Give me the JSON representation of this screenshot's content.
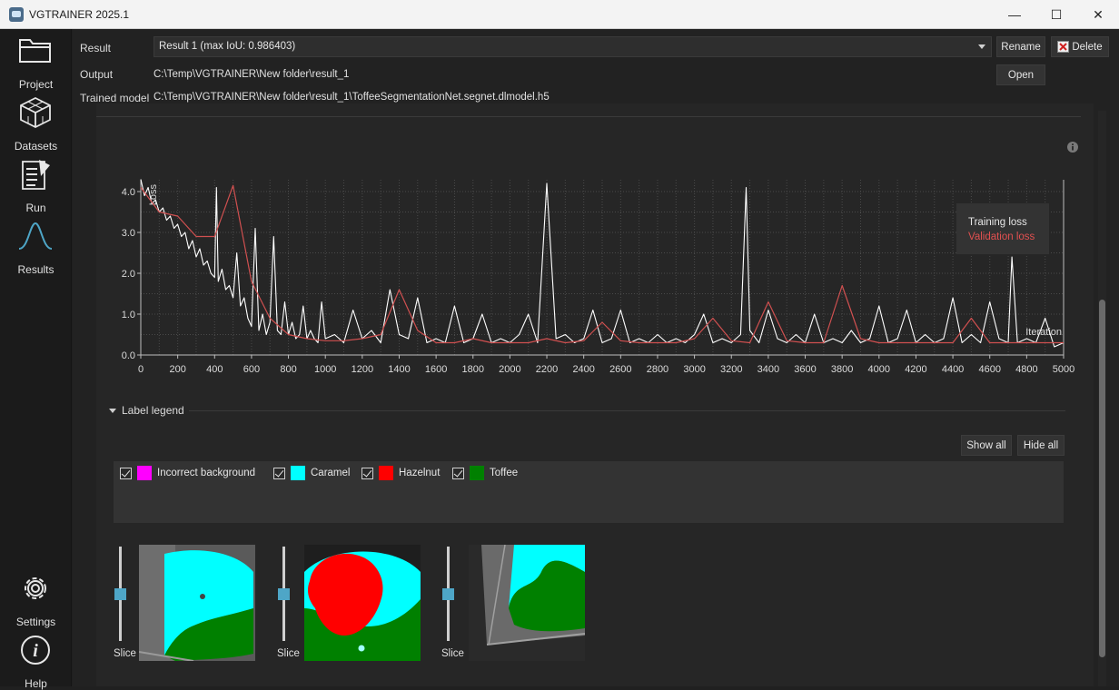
{
  "window": {
    "title": "VGTRAINER 2025.1",
    "controls": {
      "minimize": "—",
      "maximize": "☐",
      "close": "✕"
    }
  },
  "sidebar": {
    "items": [
      {
        "label": "Project",
        "icon": "folder-icon"
      },
      {
        "label": "Datasets",
        "icon": "cube-icon"
      },
      {
        "label": "Run",
        "icon": "document-run-icon"
      },
      {
        "label": "Results",
        "icon": "bell-curve-icon"
      },
      {
        "label": "Settings",
        "icon": "gear-icon"
      },
      {
        "label": "Help",
        "icon": "info-icon"
      }
    ]
  },
  "header": {
    "result_label": "Result",
    "result_value": "Result 1 (max IoU: 0.986403)",
    "rename_label": "Rename",
    "delete_label": "Delete",
    "output_label": "Output",
    "output_value": "C:\\Temp\\VGTRAINER\\New folder\\result_1",
    "open_label": "Open",
    "model_label": "Trained model",
    "model_value": "C:\\Temp\\VGTRAINER\\New folder\\result_1\\ToffeeSegmentationNet.segnet.dlmodel.h5"
  },
  "chart_data": {
    "type": "line",
    "ylabel": "Loss",
    "xlabel": "Iteration",
    "xlim": [
      0,
      5000
    ],
    "ylim": [
      0,
      4.2
    ],
    "x_ticks": [
      "0",
      "200",
      "400",
      "600",
      "800",
      "1000",
      "1200",
      "1400",
      "1600",
      "1800",
      "2000",
      "2200",
      "2400",
      "2600",
      "2800",
      "3000",
      "3200",
      "3400",
      "3600",
      "3800",
      "4000",
      "4200",
      "4400",
      "4600",
      "4800",
      "5000"
    ],
    "y_ticks": [
      "0.0",
      "1.0",
      "2.0",
      "3.0",
      "4.0"
    ],
    "grid": true,
    "legend_position": "top-right",
    "series": [
      {
        "name": "Training loss",
        "color": "#ffffff",
        "x": [
          0,
          20,
          40,
          60,
          80,
          100,
          120,
          140,
          160,
          180,
          200,
          220,
          240,
          260,
          280,
          300,
          320,
          340,
          360,
          380,
          400,
          410,
          420,
          440,
          460,
          480,
          500,
          520,
          540,
          560,
          580,
          600,
          620,
          640,
          660,
          680,
          700,
          720,
          740,
          760,
          780,
          800,
          820,
          840,
          860,
          880,
          900,
          920,
          940,
          960,
          980,
          1000,
          1050,
          1100,
          1150,
          1200,
          1250,
          1300,
          1350,
          1400,
          1450,
          1500,
          1550,
          1600,
          1650,
          1700,
          1750,
          1800,
          1850,
          1900,
          1950,
          2000,
          2050,
          2100,
          2150,
          2200,
          2250,
          2300,
          2350,
          2400,
          2450,
          2500,
          2550,
          2600,
          2650,
          2700,
          2750,
          2800,
          2850,
          2900,
          2950,
          3000,
          3050,
          3100,
          3150,
          3200,
          3250,
          3280,
          3300,
          3350,
          3400,
          3450,
          3500,
          3550,
          3600,
          3650,
          3700,
          3750,
          3800,
          3850,
          3900,
          3950,
          4000,
          4050,
          4100,
          4150,
          4200,
          4250,
          4300,
          4350,
          4400,
          4450,
          4500,
          4550,
          4600,
          4650,
          4700,
          4720,
          4750,
          4800,
          4850,
          4900,
          4950,
          5000
        ],
        "values": [
          4.3,
          3.9,
          4.1,
          3.7,
          3.8,
          3.5,
          3.6,
          3.3,
          3.4,
          3.1,
          3.2,
          2.9,
          3.0,
          2.6,
          2.8,
          2.4,
          2.6,
          2.2,
          2.3,
          2.0,
          1.9,
          4.1,
          1.8,
          2.1,
          1.6,
          1.7,
          1.4,
          2.5,
          1.2,
          1.4,
          0.9,
          0.7,
          3.1,
          0.6,
          1.0,
          0.5,
          0.8,
          2.9,
          0.6,
          0.5,
          1.3,
          0.5,
          0.8,
          0.4,
          0.5,
          1.2,
          0.4,
          0.6,
          0.4,
          0.3,
          1.3,
          0.4,
          0.5,
          0.3,
          1.1,
          0.4,
          0.6,
          0.3,
          1.6,
          0.5,
          0.4,
          1.4,
          0.3,
          0.4,
          0.3,
          1.2,
          0.3,
          0.4,
          1.0,
          0.3,
          0.4,
          0.3,
          0.5,
          1.0,
          0.3,
          4.2,
          0.4,
          0.5,
          0.3,
          0.4,
          1.1,
          0.3,
          0.4,
          1.1,
          0.3,
          0.4,
          0.3,
          0.5,
          0.3,
          0.4,
          0.3,
          0.5,
          1.0,
          0.3,
          0.4,
          0.3,
          0.5,
          4.1,
          0.6,
          0.3,
          1.1,
          0.4,
          0.3,
          0.5,
          0.3,
          1.0,
          0.3,
          0.4,
          0.3,
          0.6,
          0.3,
          0.4,
          1.2,
          0.3,
          0.4,
          1.1,
          0.3,
          0.5,
          0.3,
          0.4,
          1.4,
          0.3,
          0.5,
          0.3,
          1.3,
          0.4,
          0.3,
          2.4,
          0.3,
          0.4,
          0.3,
          0.9,
          0.2,
          0.3
        ]
      },
      {
        "name": "Validation loss",
        "color": "#d05050",
        "x": [
          0,
          100,
          200,
          300,
          400,
          500,
          600,
          700,
          800,
          900,
          1000,
          1100,
          1200,
          1300,
          1400,
          1500,
          1600,
          1700,
          1800,
          1900,
          2000,
          2100,
          2200,
          2300,
          2400,
          2500,
          2600,
          2700,
          2800,
          2900,
          3000,
          3100,
          3200,
          3300,
          3400,
          3500,
          3600,
          3700,
          3800,
          3900,
          4000,
          4100,
          4200,
          4300,
          4400,
          4500,
          4600,
          4700,
          4800,
          4900,
          5000
        ],
        "values": [
          4.1,
          3.5,
          3.4,
          2.9,
          2.9,
          4.15,
          1.8,
          0.9,
          0.5,
          0.4,
          0.35,
          0.35,
          0.4,
          0.5,
          1.6,
          0.6,
          0.3,
          0.3,
          0.4,
          0.3,
          0.3,
          0.3,
          0.4,
          0.3,
          0.35,
          0.8,
          0.35,
          0.3,
          0.3,
          0.3,
          0.4,
          0.9,
          0.35,
          0.3,
          1.3,
          0.35,
          0.3,
          0.3,
          1.7,
          0.4,
          0.3,
          0.3,
          0.3,
          0.3,
          0.3,
          0.9,
          0.3,
          0.3,
          0.3,
          0.3,
          0.3
        ]
      }
    ]
  },
  "legend": {
    "header": "Label legend",
    "show_all": "Show all",
    "hide_all": "Hide all",
    "items": [
      {
        "label": "Incorrect background",
        "color": "#ff00ff",
        "checked": true
      },
      {
        "label": "Caramel",
        "color": "#00ffff",
        "checked": true
      },
      {
        "label": "Hazelnut",
        "color": "#ff0000",
        "checked": true
      },
      {
        "label": "Toffee",
        "color": "#008000",
        "checked": true
      }
    ]
  },
  "slices": [
    {
      "label": "Slice",
      "slider_value": 0.5
    },
    {
      "label": "Slice",
      "slider_value": 0.5
    },
    {
      "label": "Slice",
      "slider_value": 0.5
    }
  ]
}
